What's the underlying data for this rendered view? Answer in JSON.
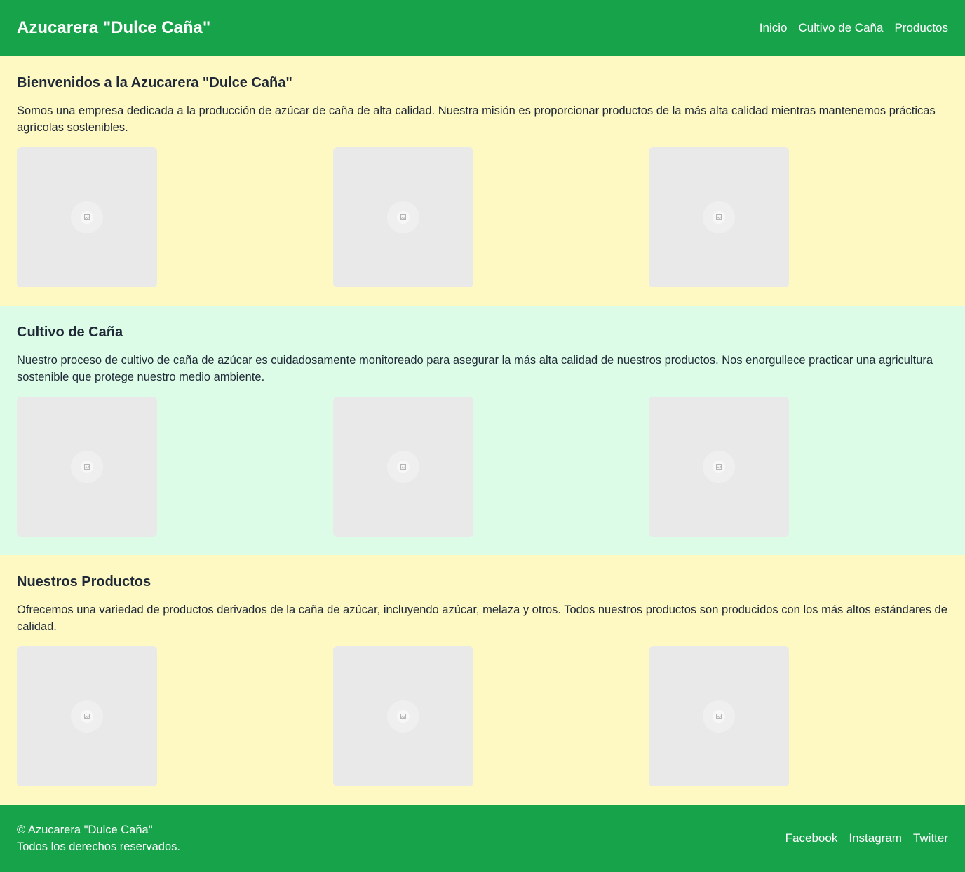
{
  "header": {
    "brand": "Azucarera \"Dulce Caña\"",
    "nav": [
      "Inicio",
      "Cultivo de Caña",
      "Productos"
    ]
  },
  "sections": [
    {
      "title": "Bienvenidos a la Azucarera \"Dulce Caña\"",
      "text": "Somos una empresa dedicada a la producción de azúcar de caña de alta calidad. Nuestra misión es proporcionar productos de la más alta calidad mientras mantenemos prácticas agrícolas sostenibles.",
      "background": "#fef9c3"
    },
    {
      "title": "Cultivo de Caña",
      "text": "Nuestro proceso de cultivo de caña de azúcar es cuidadosamente monitoreado para asegurar la más alta calidad de nuestros productos. Nos enorgullece practicar una agricultura sostenible que protege nuestro medio ambiente.",
      "background": "#dcfce7"
    },
    {
      "title": "Nuestros Productos",
      "text": "Ofrecemos una variedad de productos derivados de la caña de azúcar, incluyendo azúcar, melaza y otros. Todos nuestros productos son producidos con los más altos estándares de calidad.",
      "background": "#fef9c3"
    }
  ],
  "footer": {
    "copyright": "© Azucarera \"Dulce Caña\"",
    "rights": "Todos los derechos reservados.",
    "links": [
      "Facebook",
      "Instagram",
      "Twitter"
    ]
  },
  "colors": {
    "brand_green": "#16a34a",
    "section_yellow": "#fef9c3",
    "section_green": "#dcfce7",
    "image_placeholder": "#e9e9e9"
  },
  "icons": {
    "image_placeholder": "image-placeholder-icon"
  }
}
